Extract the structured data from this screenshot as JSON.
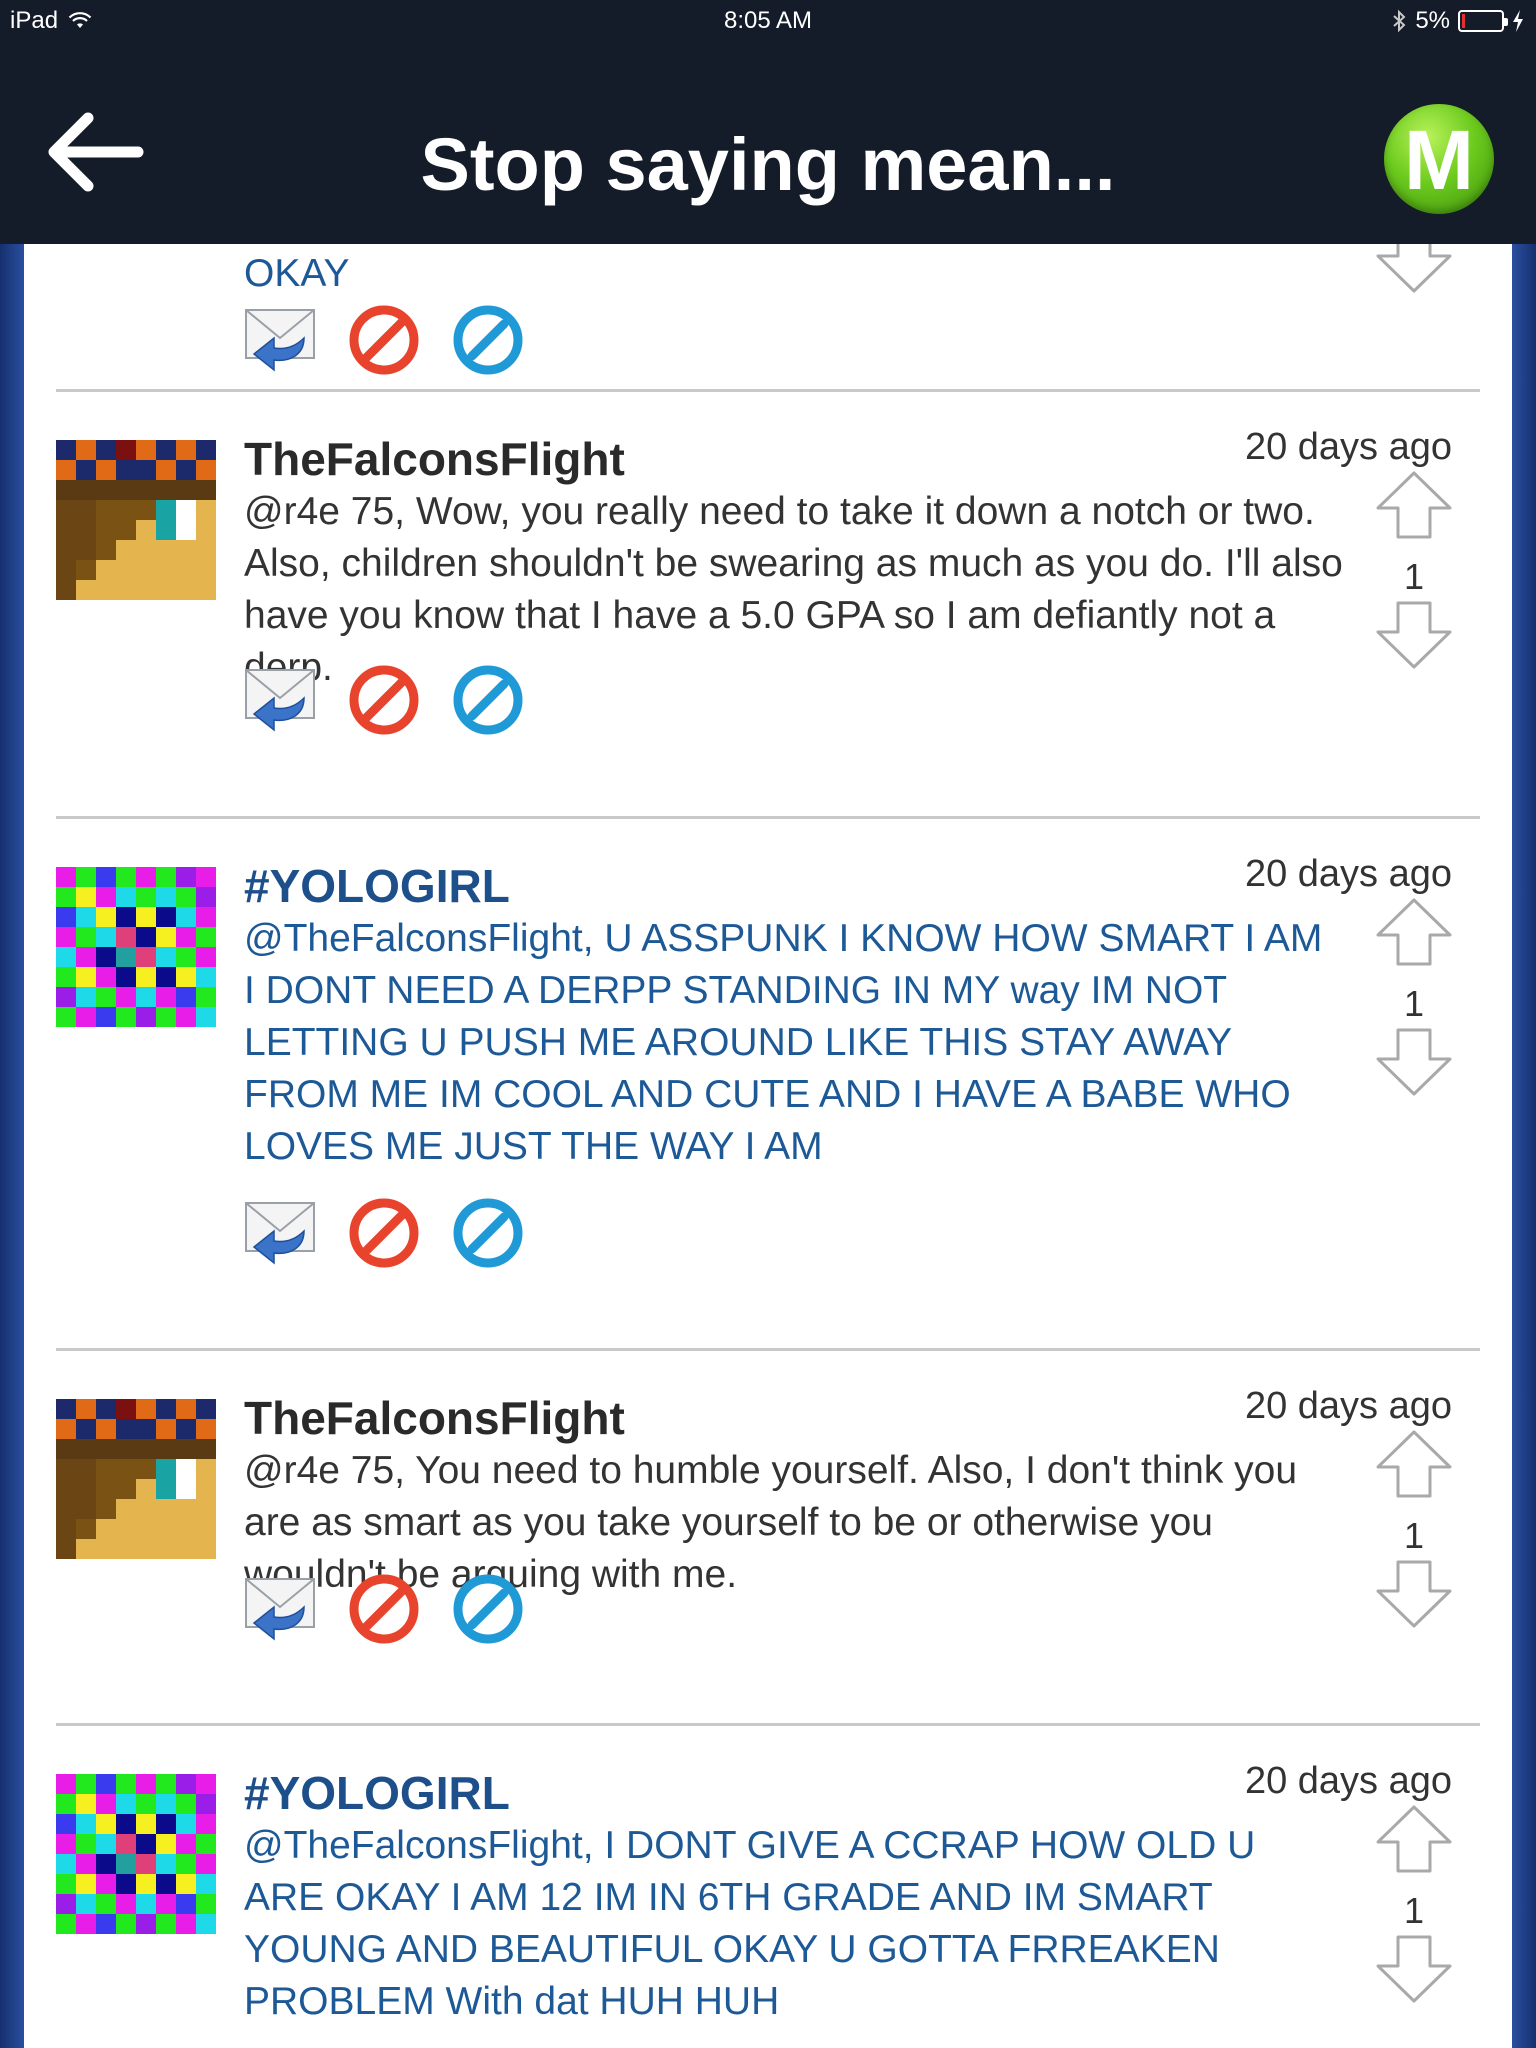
{
  "status_bar": {
    "device": "iPad",
    "time": "8:05 AM",
    "battery": "5%",
    "battery_level": 0.05
  },
  "nav": {
    "title": "Stop saying mean...",
    "right_button_letter": "M"
  },
  "top_partial": {
    "text_fragment": "OKAY"
  },
  "comments": [
    {
      "username": "TheFalconsFlight",
      "timestamp": "20 days ago",
      "body": "@r4e 75, Wow, you really need to take it down a notch or two. Also, children shouldn't be swearing as much as you do. I'll also have you know that I have a 5.0 GPA so I am defiantly not a derp.",
      "votes": "1"
    },
    {
      "username": "#YOLOGIRL",
      "timestamp": "20 days ago",
      "body": "@TheFalconsFlight, U ASSPUNK I KNOW HOW SMART I AM I DONT NEED A DERPP STANDING IN MY way IM NOT LETTING U PUSH ME AROUND LIKE THIS STAY AWAY FROM ME IM COOL AND CUTE AND I HAVE A BABE WHO LOVES ME JUST THE WAY I AM",
      "votes": "1"
    },
    {
      "username": "TheFalconsFlight",
      "timestamp": "20 days ago",
      "body": "@r4e 75, You need to humble yourself. Also, I don't think you are as smart as you take yourself to be or otherwise you wouldn't be arguing with me.",
      "votes": "1"
    },
    {
      "username": "#YOLOGIRL",
      "timestamp": "20 days ago",
      "body": "@TheFalconsFlight, I DONT GIVE A CCRAP HOW OLD U ARE OKAY I AM 12 IM IN 6TH GRADE AND IM SMART YOUNG AND BEAUTIFUL OKAY U GOTTA FRREAKEN PROBLEM  With dat HUH HUH",
      "votes": "1"
    }
  ],
  "colors": {
    "nav_background": "#131c28",
    "username_dark": "#2a2a2a",
    "username_blue": "#1d4f8a",
    "body_blue": "#1d5996",
    "brand_green": "#6dcb1e"
  },
  "icons": {
    "back": "arrow-left-icon",
    "reply": "reply-envelope-icon",
    "report": "report-red-circle-slash-icon",
    "block": "block-blue-circle-slash-icon",
    "upvote": "arrow-up-outline-icon",
    "downvote": "arrow-down-outline-icon"
  }
}
